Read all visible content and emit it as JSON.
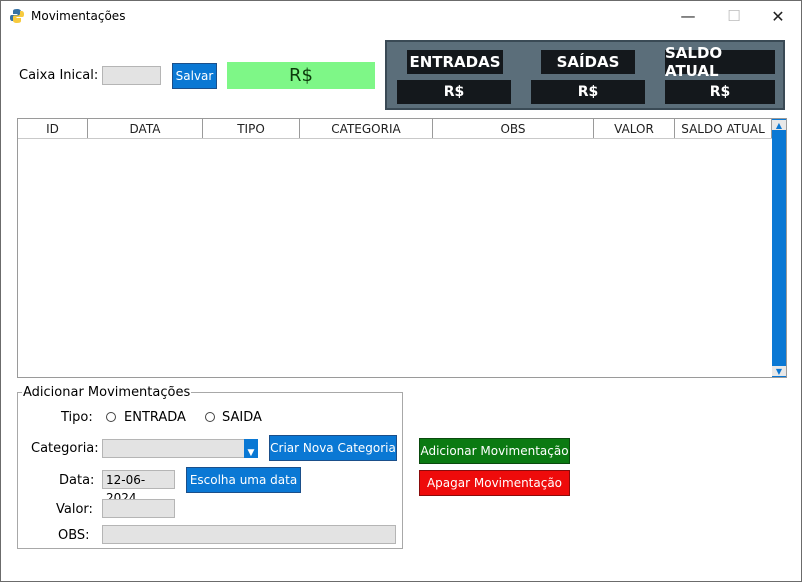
{
  "window": {
    "title": "Movimentações",
    "minimize_glyph": "—",
    "maximize_glyph": "☐",
    "close_glyph": "✕"
  },
  "top": {
    "caixa_label": "Caixa Inical:",
    "caixa_value": "",
    "save_label": "Salvar",
    "total_display": "R$"
  },
  "summary": {
    "headers": [
      "ENTRADAS",
      "SAÍDAS",
      "SALDO ATUAL"
    ],
    "values": [
      "R$",
      "R$",
      "R$"
    ]
  },
  "table": {
    "columns": [
      "ID",
      "DATA",
      "TIPO",
      "CATEGORIA",
      "OBS",
      "VALOR",
      "SALDO ATUAL"
    ],
    "rows": []
  },
  "form": {
    "group_title": "Adicionar Movimentações",
    "tipo_label": "Tipo:",
    "tipo_options": [
      "ENTRADA",
      "SAIDA"
    ],
    "categoria_label": "Categoria:",
    "categoria_value": "",
    "new_category_label": "Criar Nova Categoria",
    "data_label": "Data:",
    "data_value": "12-06-2024",
    "choose_date_label": "Escolha uma data",
    "valor_label": "Valor:",
    "valor_value": "",
    "obs_label": "OBS:",
    "obs_value": ""
  },
  "actions": {
    "add_label": "Adicionar Movimentação",
    "delete_label": "Apagar Movimentação"
  },
  "colors": {
    "accent": "#0a78d4",
    "total_bg": "#7ef787",
    "summary_bg": "#5b6e7a",
    "add_bg": "#0b7a12",
    "delete_bg": "#ee0b0b"
  }
}
